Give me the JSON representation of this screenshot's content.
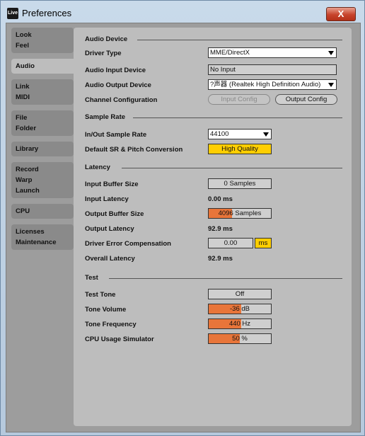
{
  "window": {
    "logo_text": "Live",
    "title": "Preferences",
    "close_label": "X"
  },
  "sidebar": {
    "groups": [
      {
        "items": [
          "Look",
          "Feel"
        ]
      },
      {
        "items": [
          "Audio"
        ]
      },
      {
        "items": [
          "Link",
          "MIDI"
        ]
      },
      {
        "items": [
          "File",
          "Folder"
        ]
      },
      {
        "items": [
          "Library"
        ]
      },
      {
        "items": [
          "Record",
          "Warp",
          "Launch"
        ]
      },
      {
        "items": [
          "CPU"
        ]
      },
      {
        "items": [
          "Licenses",
          "Maintenance"
        ]
      }
    ],
    "active_group": 1
  },
  "sections": {
    "audio_device": "Audio Device",
    "sample_rate": "Sample Rate",
    "latency": "Latency",
    "test": "Test"
  },
  "labels": {
    "driver_type": "Driver Type",
    "audio_input_device": "Audio Input Device",
    "audio_output_device": "Audio Output Device",
    "channel_configuration": "Channel Configuration",
    "inout_sample_rate": "In/Out Sample Rate",
    "default_sr_conversion": "Default SR & Pitch Conversion",
    "input_buffer_size": "Input Buffer Size",
    "input_latency": "Input Latency",
    "output_buffer_size": "Output Buffer Size",
    "output_latency": "Output Latency",
    "driver_error_compensation": "Driver Error Compensation",
    "overall_latency": "Overall Latency",
    "test_tone": "Test Tone",
    "tone_volume": "Tone Volume",
    "tone_frequency": "Tone Frequency",
    "cpu_usage_simulator": "CPU Usage Simulator"
  },
  "values": {
    "driver_type": "MME/DirectX",
    "audio_input_device": "No Input",
    "audio_output_device": "?声器 (Realtek High Definition Audio)",
    "input_config": "Input Config",
    "output_config": "Output Config",
    "sample_rate": "44100",
    "sr_conversion": "High Quality",
    "input_buffer_size": "0 Samples",
    "input_latency": "0.00 ms",
    "output_buffer_size": "4096 Samples",
    "output_latency": "92.9 ms",
    "driver_error_compensation": "0.00",
    "driver_error_unit": "ms",
    "overall_latency": "92.9 ms",
    "test_tone": "Off",
    "tone_volume": "-36 dB",
    "tone_frequency": "440 Hz",
    "cpu_usage_simulator": "50 %"
  },
  "levels": {
    "output_buffer_size": 0.38,
    "tone_volume": 0.52,
    "tone_frequency": 0.52,
    "cpu_usage_simulator": 0.5
  },
  "colors": {
    "accent_orange": "#e8753a",
    "accent_yellow": "#ffce00",
    "panel_gray": "#bdbdbd",
    "close_red": "#c7432b"
  }
}
